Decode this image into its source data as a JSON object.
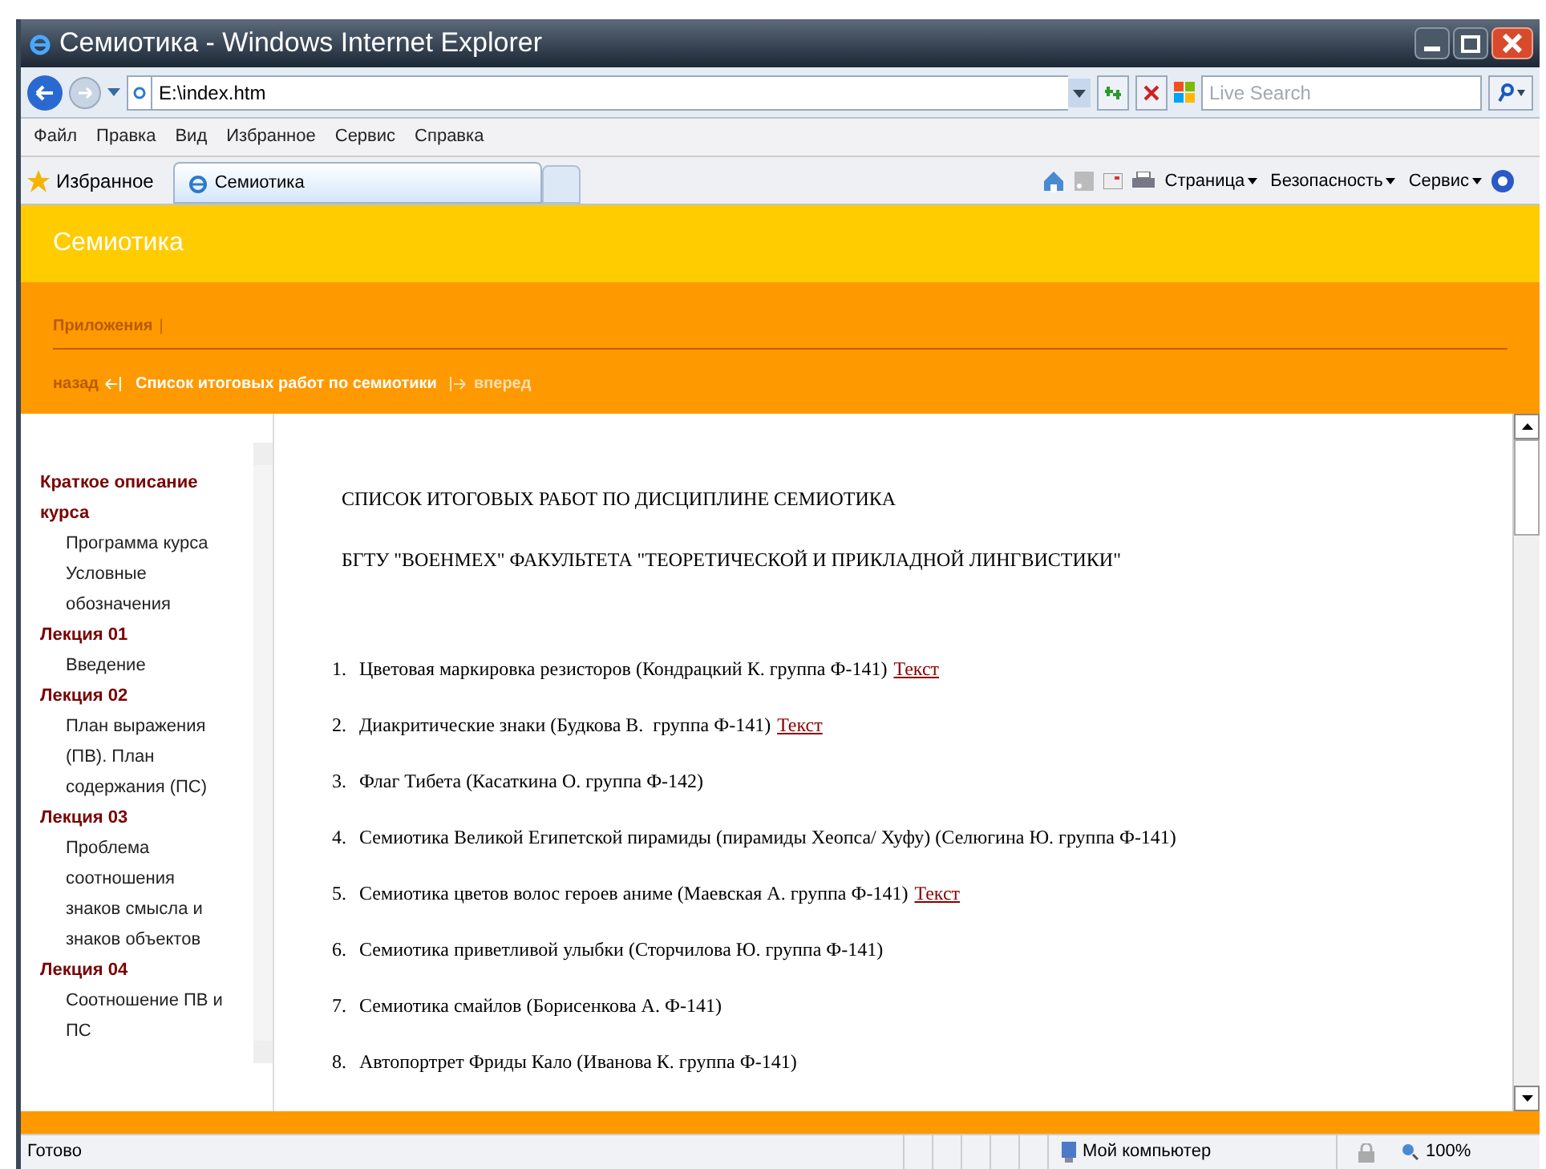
{
  "window": {
    "title": "Семиотика - Windows Internet Explorer"
  },
  "address_bar": {
    "value": "E:\\index.htm"
  },
  "search": {
    "placeholder": "Live Search"
  },
  "menu": [
    "Файл",
    "Правка",
    "Вид",
    "Избранное",
    "Сервис",
    "Справка"
  ],
  "favorites": {
    "label": "Избранное"
  },
  "tabs": [
    {
      "label": "Семиотика",
      "selected": true
    }
  ],
  "command_bar": [
    "Страница",
    "Безопасность",
    "Сервис"
  ],
  "page": {
    "site_title": "Семиотика",
    "nav_link": "Приложения",
    "nav_separator": "|",
    "back": "назад",
    "current": "Список итоговых работ по семиотики",
    "forward": "вперед",
    "sidebar": [
      {
        "label": "Краткое описание курса",
        "children": [
          {
            "label": "Программа курса"
          },
          {
            "label": "Условные обозначения"
          }
        ]
      },
      {
        "label": "Лекция 01",
        "children": [
          {
            "label": "Введение"
          }
        ]
      },
      {
        "label": "Лекция 02",
        "children": [
          {
            "label": "План выражения (ПВ). План содержания (ПС)"
          }
        ]
      },
      {
        "label": "Лекция 03",
        "children": [
          {
            "label": "Проблема соотношения знаков смысла и знаков объектов"
          }
        ]
      },
      {
        "label": "Лекция 04",
        "children": [
          {
            "label": "Соотношение ПВ и ПС"
          }
        ]
      }
    ],
    "headings": [
      "СПИСОК ИТОГОВЫХ РАБОТ ПО ДИСЦИПЛИНЕ СЕМИОТИКА",
      "БГТУ \"ВОЕНМЕХ\" ФАКУЛЬТЕТА \"ТЕОРЕТИЧЕСКОЙ И ПРИКЛАДНОЙ ЛИНГВИСТИКИ\""
    ],
    "works": [
      {
        "number": "1.",
        "text": "Цветовая маркировка резисторов (Кондрацкий К. группа Ф-141)",
        "link": "Текст"
      },
      {
        "number": "2.",
        "text": "Диакритические знаки (Будкова В.  группа Ф-141)",
        "link": "Текст"
      },
      {
        "number": "3.",
        "text": "Флаг Тибета (Касаткина О. группа Ф-142)"
      },
      {
        "number": "4.",
        "text": "Семиотика Великой Египетской пирамиды (пирамиды Хеопса/ Хуфу) (Селюгина Ю. группа Ф-141)"
      },
      {
        "number": "5.",
        "text": "Семиотика цветов волос героев аниме (Маевская А. группа Ф-141)",
        "link": "Текст"
      },
      {
        "number": "6.",
        "text": "Семиотика приветливой улыбки (Сторчилова Ю. группа Ф-141)"
      },
      {
        "number": "7.",
        "text": "Семиотика смайлов (Борисенкова А. Ф-141)"
      },
      {
        "number": "8.",
        "text": "Автопортрет Фриды Кало (Иванова К. группа Ф-141)"
      }
    ]
  },
  "status_bar": {
    "text": "Готово",
    "zone": "Мой компьютер",
    "zoom": "100%"
  }
}
